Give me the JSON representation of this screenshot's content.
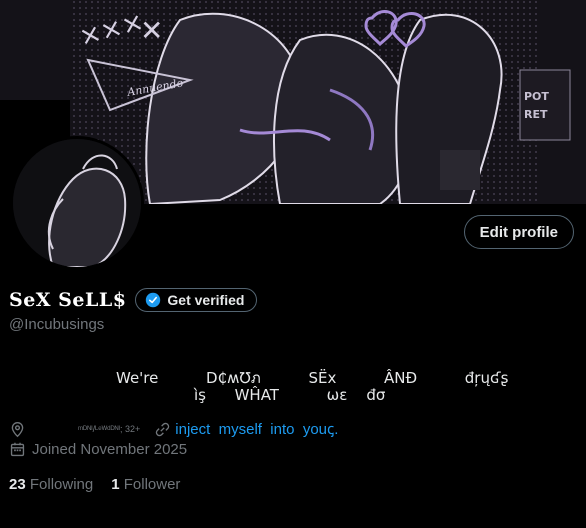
{
  "profile": {
    "display_name": "SeX SeLL$",
    "handle": "@Incubusings",
    "verify_label": "Get verified",
    "edit_label": "Edit profile",
    "bio_line1": "We're          D₵ʍ℧ภ          SЁx          ÂNĐ          đŗųʛʂ",
    "bio_line2": "ìş      WĤAT          ωε    đσ",
    "location": "ᵐᴰᴺᴵ/ᴸᵉᵂᵈᴰᴺᴵ; 32+",
    "link_text": "inject  myself  into  youꞔ.",
    "joined": "Joined November 2025",
    "following_count": "23",
    "following_label": "Following",
    "followers_count": "1",
    "followers_label": "Follower"
  },
  "banner": {
    "text": "Annuendo"
  },
  "colors": {
    "accent": "#1d9bf0",
    "muted": "#71767b",
    "border": "#536471",
    "purple": "#a58ad6"
  },
  "icons": [
    "location-icon",
    "link-icon",
    "calendar-icon",
    "verified-badge-icon"
  ]
}
